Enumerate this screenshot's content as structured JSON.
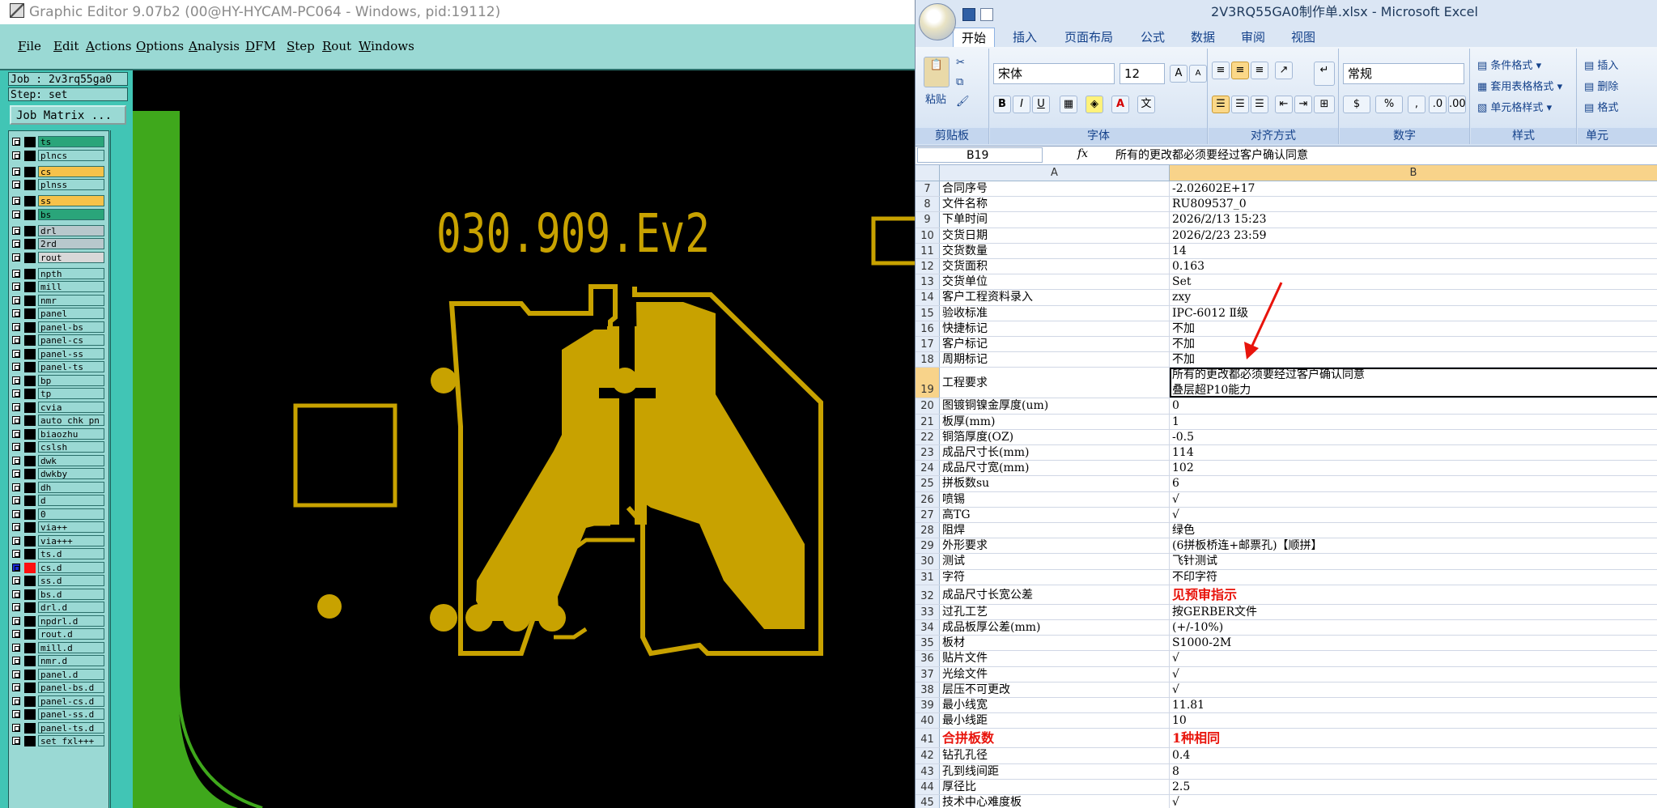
{
  "graphic_editor": {
    "title": "Graphic Editor 9.07b2 (00@HY-HYCAM-PC064 - Windows, pid:19112)",
    "menu": [
      "File",
      "Edit",
      "Actions",
      "Options",
      "Analysis",
      "DFM",
      "Step",
      "Rout",
      "Windows"
    ],
    "job_label": "Job : 2v3rq55ga0",
    "step_label": "Step: set",
    "job_matrix_button": "Job Matrix ...",
    "board_text": "030.909.Ev2",
    "colors": {
      "copper": "#c8a200",
      "profile": "#3fa81c",
      "panel_bg": "#41c5b5",
      "layer_bg": "#9ad9d4"
    },
    "layers": [
      {
        "name": "ts",
        "color": "#2aa57a"
      },
      {
        "name": "plncs",
        "color": "#9ad9d4"
      },
      {
        "name": "cs",
        "color": "#f6c24a"
      },
      {
        "name": "plnss",
        "color": "#9ad9d4"
      },
      {
        "name": "ss",
        "color": "#f6c24a"
      },
      {
        "name": "bs",
        "color": "#2aa57a"
      },
      {
        "name": "drl",
        "color": "#b8c8cc"
      },
      {
        "name": "2rd",
        "color": "#b8c8cc"
      },
      {
        "name": "rout",
        "color": "#d8d8d8"
      },
      {
        "name": "npth",
        "color": "#9ad9d4"
      },
      {
        "name": "mill",
        "color": "#9ad9d4"
      },
      {
        "name": "nmr",
        "color": "#9ad9d4"
      },
      {
        "name": "panel",
        "color": "#9ad9d4"
      },
      {
        "name": "panel-bs",
        "color": "#9ad9d4"
      },
      {
        "name": "panel-cs",
        "color": "#9ad9d4"
      },
      {
        "name": "panel-ss",
        "color": "#9ad9d4"
      },
      {
        "name": "panel-ts",
        "color": "#9ad9d4"
      },
      {
        "name": "bp",
        "color": "#9ad9d4"
      },
      {
        "name": "tp",
        "color": "#9ad9d4"
      },
      {
        "name": "cvia",
        "color": "#9ad9d4"
      },
      {
        "name": "auto_chk_pn",
        "color": "#9ad9d4"
      },
      {
        "name": "biaozhu",
        "color": "#9ad9d4"
      },
      {
        "name": "cslsh",
        "color": "#9ad9d4"
      },
      {
        "name": "dwk",
        "color": "#9ad9d4"
      },
      {
        "name": "dwkby",
        "color": "#9ad9d4"
      },
      {
        "name": "dh",
        "color": "#9ad9d4"
      },
      {
        "name": "d",
        "color": "#9ad9d4"
      },
      {
        "name": "0",
        "color": "#9ad9d4"
      },
      {
        "name": "via++",
        "color": "#9ad9d4"
      },
      {
        "name": "via+++",
        "color": "#9ad9d4"
      },
      {
        "name": "ts.d",
        "color": "#9ad9d4"
      },
      {
        "name": "cs.d",
        "color": "#9ad9d4",
        "active": true
      },
      {
        "name": "ss.d",
        "color": "#9ad9d4"
      },
      {
        "name": "bs.d",
        "color": "#9ad9d4"
      },
      {
        "name": "drl.d",
        "color": "#9ad9d4"
      },
      {
        "name": "npdrl.d",
        "color": "#9ad9d4"
      },
      {
        "name": "rout.d",
        "color": "#9ad9d4"
      },
      {
        "name": "mill.d",
        "color": "#9ad9d4"
      },
      {
        "name": "nmr.d",
        "color": "#9ad9d4"
      },
      {
        "name": "panel.d",
        "color": "#9ad9d4"
      },
      {
        "name": "panel-bs.d",
        "color": "#9ad9d4"
      },
      {
        "name": "panel-cs.d",
        "color": "#9ad9d4"
      },
      {
        "name": "panel-ss.d",
        "color": "#9ad9d4"
      },
      {
        "name": "panel-ts.d",
        "color": "#9ad9d4"
      },
      {
        "name": "set_fxl+++",
        "color": "#9ad9d4"
      }
    ]
  },
  "excel": {
    "title": "2V3RQ55GA0制作单.xlsx - Microsoft Excel",
    "tabs": [
      "开始",
      "插入",
      "页面布局",
      "公式",
      "数据",
      "审阅",
      "视图"
    ],
    "active_tab": "开始",
    "ribbon": {
      "paste_label": "粘贴",
      "font_name": "宋体",
      "font_size": "12",
      "number_format": "常规",
      "styles": [
        "条件格式",
        "套用表格格式",
        "单元格样式"
      ],
      "cells_partial": [
        "插入",
        "删除",
        "格式"
      ],
      "groups": [
        "剪贴板",
        "字体",
        "对齐方式",
        "数字",
        "样式",
        "单元"
      ]
    },
    "name_box": "B19",
    "fx": "fx",
    "formula_value": "所有的更改都必须要经过客户确认同意",
    "columns": [
      "A",
      "B"
    ],
    "rows": [
      {
        "n": "7",
        "a": "合同序号",
        "b": "-2.02602E+17"
      },
      {
        "n": "8",
        "a": "文件名称",
        "b": "RU809537_0"
      },
      {
        "n": "9",
        "a": "下单时间",
        "b": "2026/2/13 15:23"
      },
      {
        "n": "10",
        "a": "交货日期",
        "b": "2026/2/23 23:59"
      },
      {
        "n": "11",
        "a": "交货数量",
        "b": "14"
      },
      {
        "n": "12",
        "a": "交货面积",
        "b": "0.163"
      },
      {
        "n": "13",
        "a": "交货单位",
        "b": "Set"
      },
      {
        "n": "14",
        "a": "客户工程资料录入",
        "b": "zxy"
      },
      {
        "n": "15",
        "a": "验收标准",
        "b": "IPC-6012 Ⅱ级"
      },
      {
        "n": "16",
        "a": "快捷标记",
        "b": "不加"
      },
      {
        "n": "17",
        "a": "客户标记",
        "b": "不加"
      },
      {
        "n": "18",
        "a": "周期标记",
        "b": "不加"
      },
      {
        "n": "19",
        "a": "工程要求",
        "b": "所有的更改都必须要经过客户确认同意\n叠层超P10能力"
      },
      {
        "n": "20",
        "a": "图镀铜镍金厚度(um)",
        "b": "0"
      },
      {
        "n": "21",
        "a": "板厚(mm)",
        "b": "1"
      },
      {
        "n": "22",
        "a": "铜箔厚度(OZ)",
        "b": "-0.5"
      },
      {
        "n": "23",
        "a": "成品尺寸长(mm)",
        "b": "114"
      },
      {
        "n": "24",
        "a": "成品尺寸宽(mm)",
        "b": "102"
      },
      {
        "n": "25",
        "a": "拼板数su",
        "b": "6"
      },
      {
        "n": "26",
        "a": "喷锡",
        "b": "√"
      },
      {
        "n": "27",
        "a": "高TG",
        "b": "√"
      },
      {
        "n": "28",
        "a": "阻焊",
        "b": "绿色"
      },
      {
        "n": "29",
        "a": "外形要求",
        "b": "(6拼板桥连+邮票孔)【顺拼】"
      },
      {
        "n": "30",
        "a": "测试",
        "b": "飞针测试"
      },
      {
        "n": "31",
        "a": "字符",
        "b": "不印字符"
      },
      {
        "n": "32",
        "a": "成品尺寸长宽公差",
        "b": "见预审指示"
      },
      {
        "n": "33",
        "a": "过孔工艺",
        "b": "按GERBER文件"
      },
      {
        "n": "34",
        "a": "成品板厚公差(mm)",
        "b": "(+/-10%)"
      },
      {
        "n": "35",
        "a": "板材",
        "b": "S1000-2M"
      },
      {
        "n": "36",
        "a": "贴片文件",
        "b": "√"
      },
      {
        "n": "37",
        "a": "光绘文件",
        "b": "√"
      },
      {
        "n": "38",
        "a": "层压不可更改",
        "b": "√"
      },
      {
        "n": "39",
        "a": "最小线宽",
        "b": "11.81"
      },
      {
        "n": "40",
        "a": "最小线距",
        "b": "10"
      },
      {
        "n": "41",
        "a": "合拼板数",
        "b": "1种相同"
      },
      {
        "n": "42",
        "a": "钻孔孔径",
        "b": "0.4"
      },
      {
        "n": "43",
        "a": "孔到线间距",
        "b": "8"
      },
      {
        "n": "44",
        "a": "厚径比",
        "b": "2.5"
      },
      {
        "n": "45",
        "a": "技术中心难度板",
        "b": "√"
      }
    ],
    "annotation_color": "#e8140c"
  }
}
